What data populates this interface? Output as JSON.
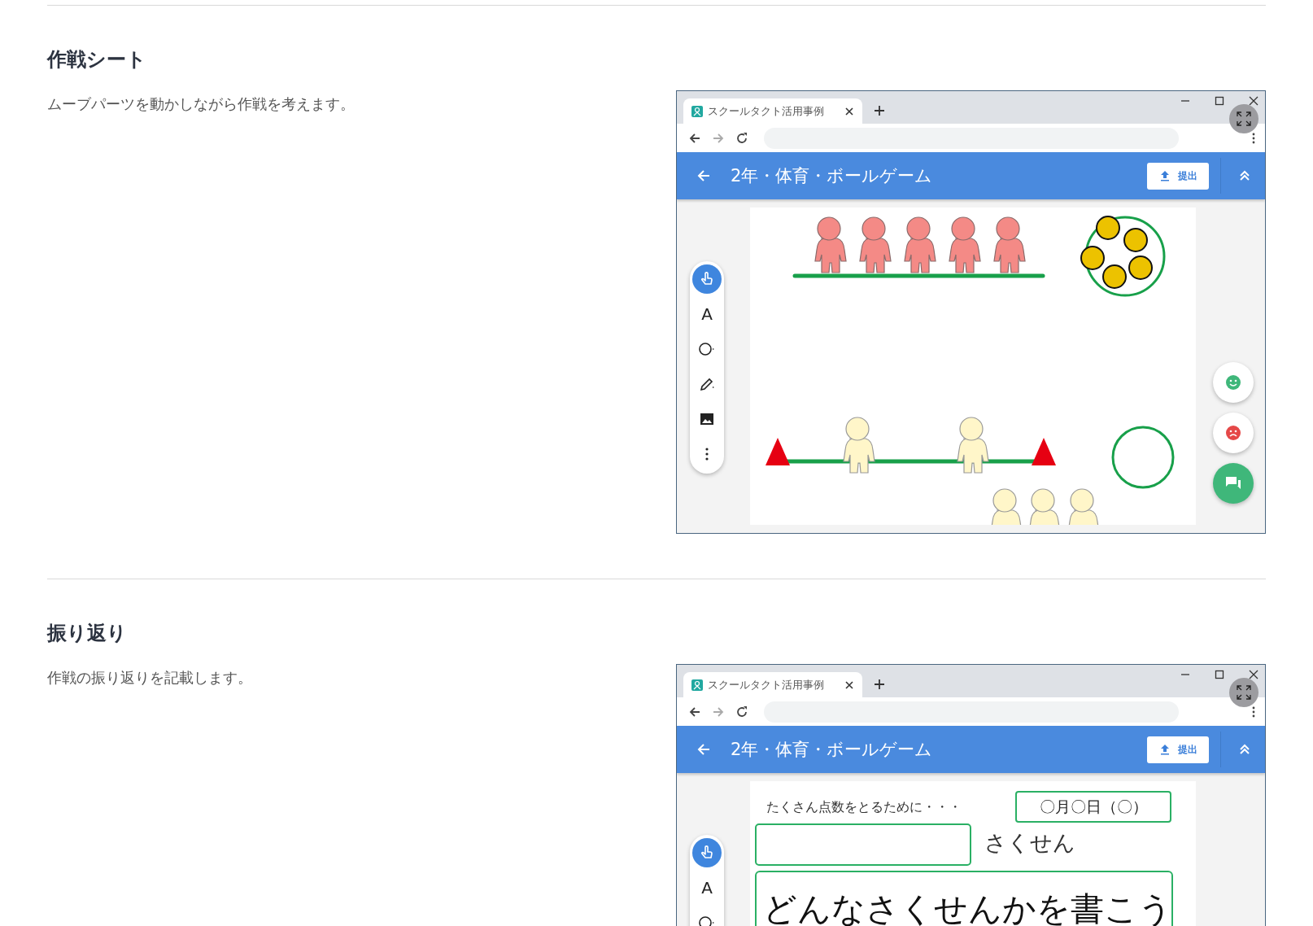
{
  "sections": [
    {
      "title": "作戦シート",
      "description": "ムーブパーツを動かしながら作戦を考えます。",
      "window": {
        "tab_title": "スクールタクト活用事例",
        "app_title": "2年・体育・ボールゲーム",
        "submit_label": "提出",
        "tools": [
          {
            "kind": "pointer",
            "selected": true
          },
          {
            "kind": "text",
            "label": "A",
            "selected": false
          },
          {
            "kind": "shape",
            "selected": false
          },
          {
            "kind": "pen",
            "selected": false
          },
          {
            "kind": "image",
            "selected": false
          },
          {
            "kind": "more",
            "selected": false
          }
        ],
        "sheet": {
          "kind": "diagram"
        },
        "actions": [
          {
            "kind": "smile"
          },
          {
            "kind": "frown"
          },
          {
            "kind": "chat"
          }
        ]
      }
    },
    {
      "title": "振り返り",
      "description": "作戦の振り返りを記載します。",
      "window": {
        "tab_title": "スクールタクト活用事例",
        "app_title": "2年・体育・ボールゲーム",
        "submit_label": "提出",
        "tools": [
          {
            "kind": "pointer",
            "selected": true
          },
          {
            "kind": "text",
            "label": "A",
            "selected": false
          },
          {
            "kind": "shape",
            "selected": false
          }
        ],
        "sheet": {
          "kind": "worksheet",
          "prompt": "たくさん点数をとるために・・・",
          "date": "〇月〇日（〇）",
          "label": "さくせん",
          "instruction": "どんなさくせんかを書こう"
        }
      }
    }
  ]
}
